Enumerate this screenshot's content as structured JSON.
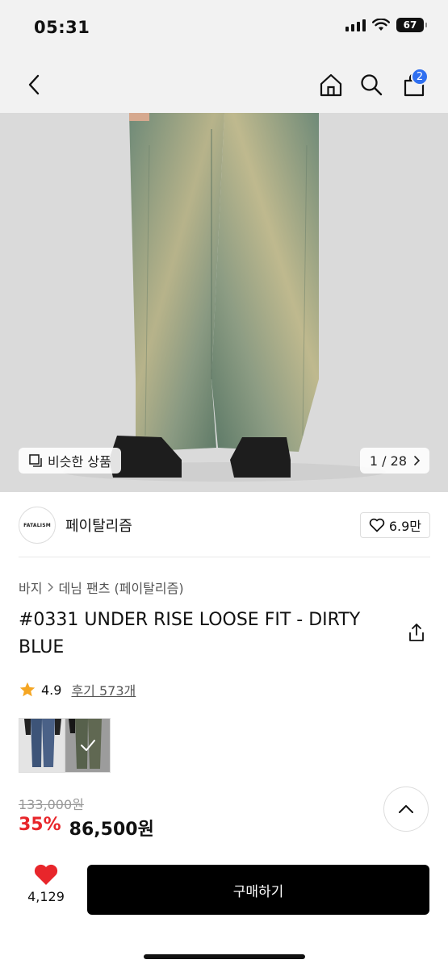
{
  "status": {
    "time": "05:31",
    "battery": "67"
  },
  "nav": {
    "cart_count": "2"
  },
  "hero": {
    "similar_label": "비슷한 상품",
    "image_counter": "1 / 28"
  },
  "brand": {
    "logo_text": "FATALISM",
    "name": "페이탈리즘",
    "likes": "6.9만"
  },
  "breadcrumb": [
    "바지",
    "데님 팬츠 (페이탈리즘)"
  ],
  "product": {
    "title": "#0331 UNDER RISE LOOSE FIT - DIRTY BLUE",
    "rating": "4.9",
    "review_label": "후기 573개",
    "original_price": "133,000원",
    "discount": "35%",
    "price": "86,500원"
  },
  "bottom": {
    "wish_count": "4,129",
    "buy_label": "구매하기"
  },
  "colors": {
    "accent": "#2f6ff0",
    "discount": "#e8262b",
    "heart": "#e8262b",
    "star": "#f5a623"
  },
  "icons": [
    "back-icon",
    "home-icon",
    "search-icon",
    "cart-icon",
    "similar-icon",
    "chevron-right-icon",
    "heart-outline-icon",
    "share-icon",
    "star-icon",
    "check-icon",
    "chevron-up-icon",
    "heart-filled-icon"
  ]
}
